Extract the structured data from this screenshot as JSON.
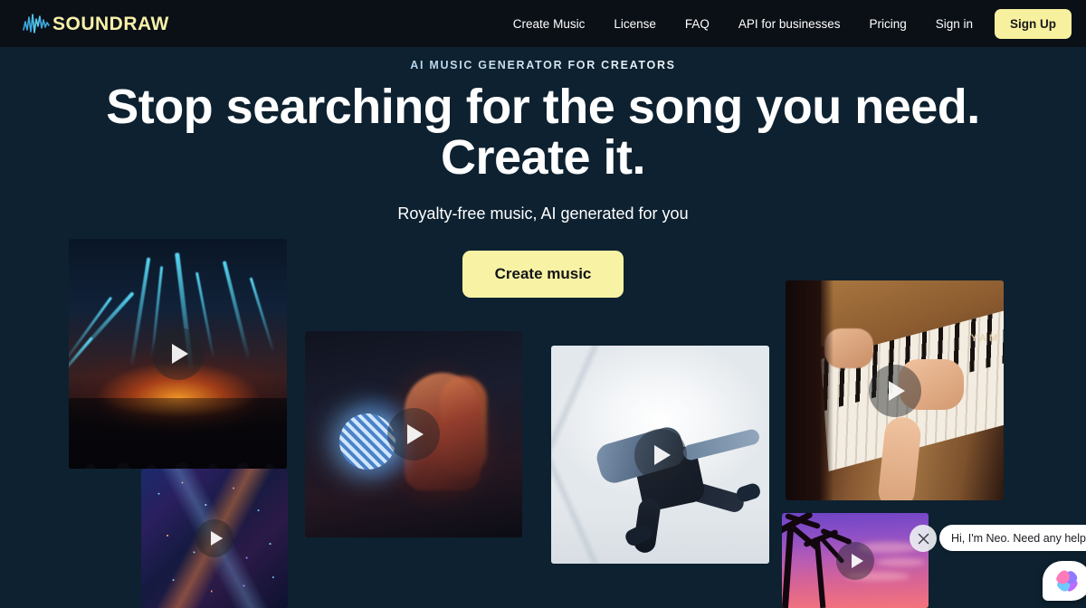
{
  "brand": {
    "name": "SOUNDRAW",
    "logo_icon": "soundwave-icon",
    "logo_text_color": "#f7f0a8",
    "wave_color": "#3da9e0"
  },
  "nav": {
    "links": [
      {
        "label": "Create Music"
      },
      {
        "label": "License"
      },
      {
        "label": "FAQ"
      },
      {
        "label": "API for businesses"
      },
      {
        "label": "Pricing"
      },
      {
        "label": "Sign in"
      }
    ],
    "signup_label": "Sign Up",
    "signup_bg": "#f7f09e",
    "bar_bg": "#0b1017"
  },
  "hero": {
    "eyebrow": "AI MUSIC GENERATOR FOR CREATORS",
    "headline_line1": "Stop searching for the song you need.",
    "headline_line2": "Create it.",
    "subhead": "Royalty-free music, AI generated for you",
    "cta_label": "Create music",
    "cta_bg": "#f8f3a4",
    "background": "#0d2130"
  },
  "cards": [
    {
      "id": "concert",
      "name": "concert-laser-show",
      "play_icon": "play-icon"
    },
    {
      "id": "city",
      "name": "aerial-night-city",
      "play_icon": "play-icon"
    },
    {
      "id": "disco",
      "name": "woman-with-disco-ball",
      "play_icon": "play-icon"
    },
    {
      "id": "dancer",
      "name": "breakdancer-white-studio",
      "play_icon": "play-icon"
    },
    {
      "id": "piano",
      "name": "hands-playing-piano",
      "play_icon": "play-icon",
      "brand_text": "YAM"
    },
    {
      "id": "sunset",
      "name": "palm-trees-sunset",
      "play_icon": "play-icon"
    }
  ],
  "chat": {
    "message": "Hi, I'm Neo. Need any help?",
    "close_icon": "close-icon",
    "launcher_icon": "neo-brain-icon"
  }
}
